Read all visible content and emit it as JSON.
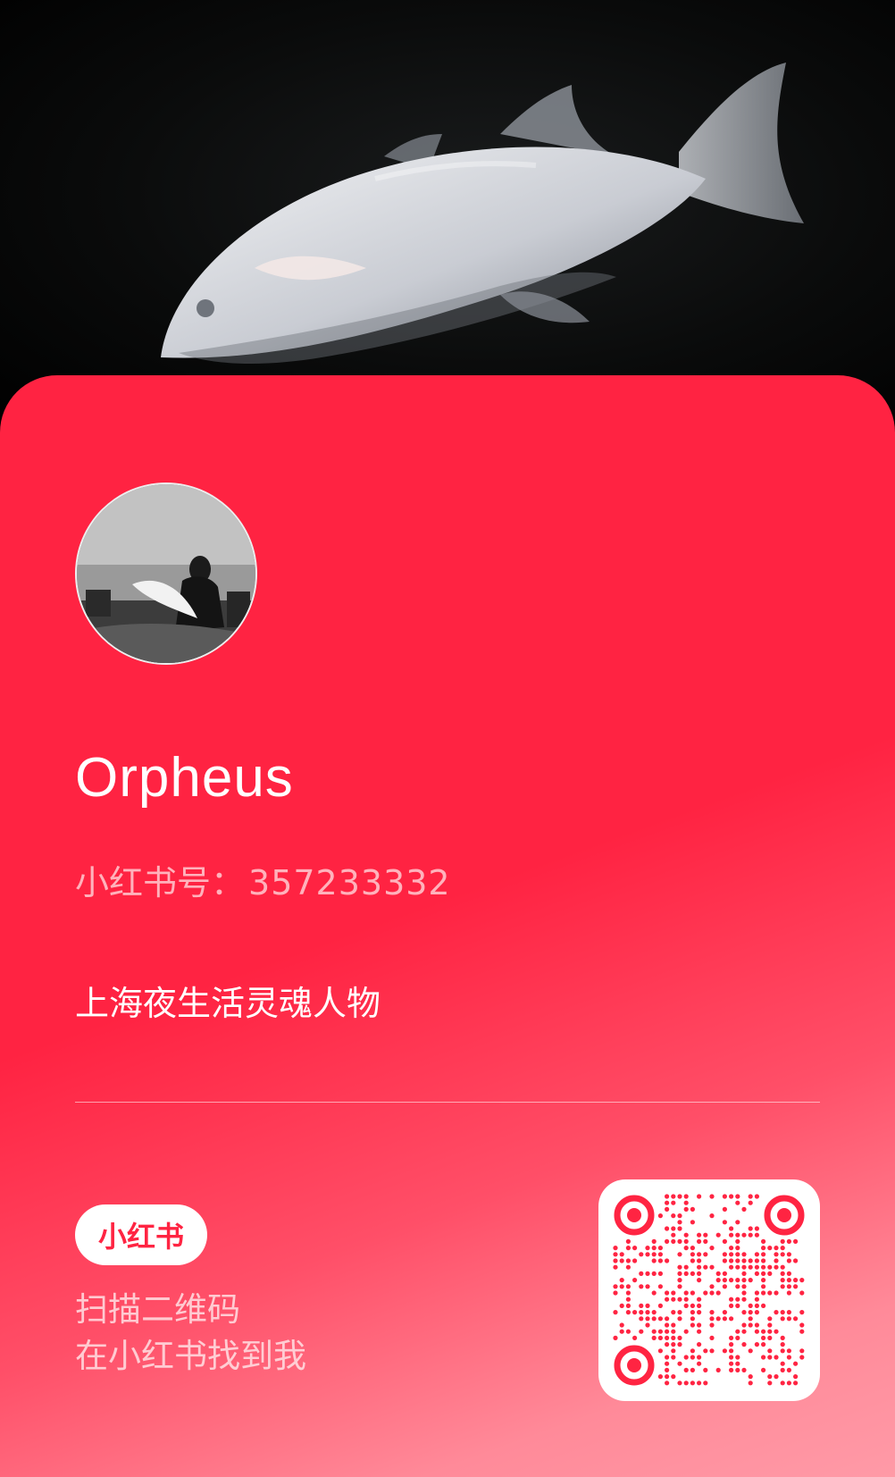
{
  "profile": {
    "username": "Orpheus",
    "id_label": "小红书号：",
    "id_value": "357233332",
    "bio": "上海夜生活灵魂人物"
  },
  "footer": {
    "logo_text": "小红书",
    "scan_line1": "扫描二维码",
    "scan_line2": "在小红书找到我"
  },
  "colors": {
    "brand_red": "#ff2342",
    "card_gradient_end": "#ff9aa7",
    "qr_red": "#ff2442"
  },
  "icons": {
    "cover": "fish-photo",
    "avatar": "user-avatar-photo",
    "logo": "xiaohongshu-logo",
    "qr": "qr-code"
  }
}
